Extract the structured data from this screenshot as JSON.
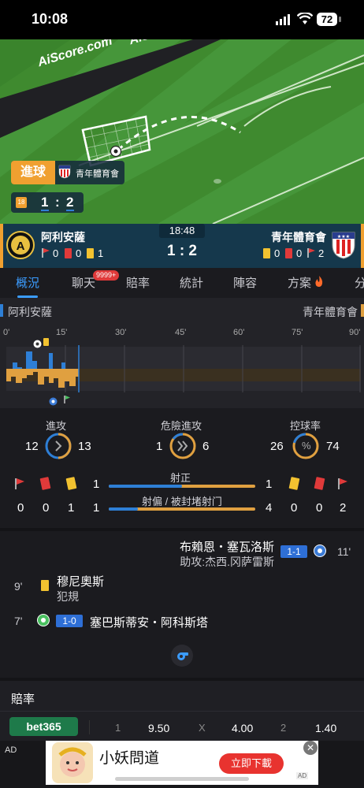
{
  "status_bar": {
    "time": "10:08",
    "battery": "72"
  },
  "pitch": {
    "watermark1": "AiScore.com",
    "watermark2": "AiScore.com",
    "event_label": "進球",
    "event_team": "青年體育會",
    "minute_badge": "18",
    "score_home": "1",
    "score_away": "2",
    "colors": {
      "grass_dark": "#3a842c",
      "grass_light": "#4a9a38",
      "event_orange": "#f0a030"
    }
  },
  "match": {
    "home_name": "阿利安薩",
    "away_name": "青年體育會",
    "time": "18:48",
    "score": "1 : 2",
    "home_corners": "0",
    "home_red": "0",
    "home_yellow": "1",
    "away_yellow": "0",
    "away_red": "0",
    "away_corners": "2"
  },
  "tabs": [
    {
      "label": "概況",
      "active": true
    },
    {
      "label": "聊天",
      "badge": "9999+"
    },
    {
      "label": "賠率"
    },
    {
      "label": "統計"
    },
    {
      "label": "陣容"
    },
    {
      "label": "方案"
    },
    {
      "label": "分"
    }
  ],
  "timeline": {
    "home": "阿利安薩",
    "away": "青年體育會",
    "ticks": [
      "0'",
      "15'",
      "30'",
      "45'",
      "60'",
      "75'",
      "90'"
    ],
    "colors": {
      "home": "#2e7fd6",
      "away": "#e0a040"
    }
  },
  "stats": {
    "attack": {
      "label": "進攻",
      "home": "12",
      "away": "13"
    },
    "dangerous": {
      "label": "危險進攻",
      "home": "1",
      "away": "6"
    },
    "possession": {
      "label": "控球率",
      "home": "26",
      "away": "74",
      "symbol": "%"
    },
    "on_target": {
      "label": "射正",
      "home": "1",
      "away": "1"
    },
    "off_target": {
      "label": "射偏 / 被封堵射门",
      "home": "1",
      "away": "4"
    },
    "home_corners": "0",
    "home_red": "0",
    "home_yellow": "1",
    "away_yellow": "0",
    "away_red": "0",
    "away_corners": "2"
  },
  "events": [
    {
      "side": "away",
      "player": "布賴恩・塞瓦洛斯",
      "detail": "助攻:杰西.冈萨雷斯",
      "score": "1-1",
      "minute": "11'"
    },
    {
      "side": "home",
      "player": "穆尼奧斯",
      "detail": "犯規",
      "minute": "9'"
    },
    {
      "side": "home",
      "player": "塞巴斯蒂安・阿科斯塔",
      "score": "1-0",
      "minute": "7'"
    }
  ],
  "odds": {
    "title": "賠率",
    "bookmaker": "bet365",
    "home_label": "1",
    "home_value": "9.50",
    "draw_label": "X",
    "draw_value": "4.00",
    "away_label": "2",
    "away_value": "1.40"
  },
  "ad": {
    "tag": "AD",
    "title": "小妖問道",
    "cta": "立即下載",
    "corner_tag": "AD"
  }
}
